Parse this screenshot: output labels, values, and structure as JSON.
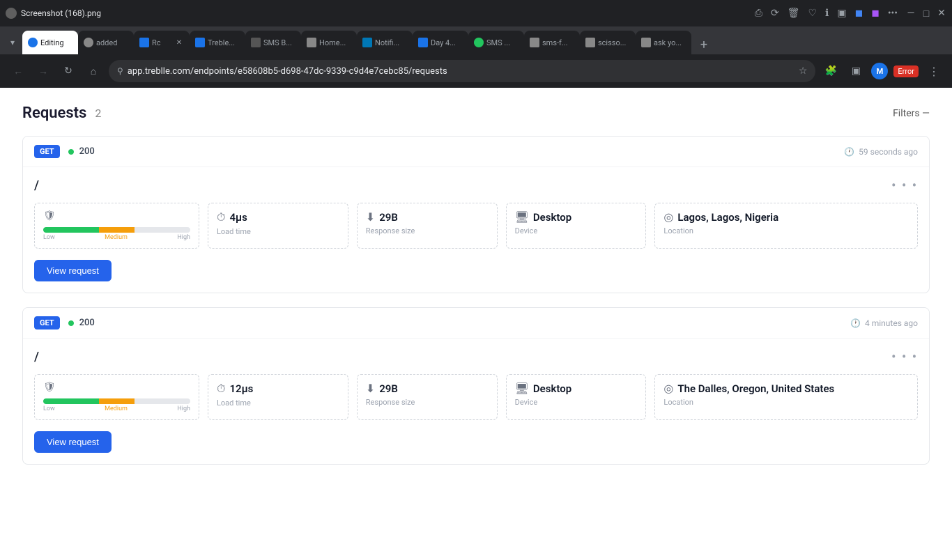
{
  "browser": {
    "title": "Screenshot (168).png",
    "url": "app.treblle.com/endpoints/e58608b5-d698-47dc-9339-c9d4e7cebc85/requests",
    "profile_initial": "M",
    "error_label": "Error"
  },
  "tabs": [
    {
      "id": "t1",
      "label": "Editing",
      "favicon_color": "#1a73e8",
      "active": true,
      "has_close": false
    },
    {
      "id": "t2",
      "label": "added",
      "favicon_color": "#888",
      "active": false,
      "has_close": false
    },
    {
      "id": "t3",
      "label": "Rc",
      "favicon_color": "#1a73e8",
      "active": false,
      "has_close": true
    },
    {
      "id": "t4",
      "label": "Treble...",
      "favicon_color": "#1a73e8",
      "active": false,
      "has_close": false
    },
    {
      "id": "t5",
      "label": "SMS B...",
      "favicon_color": "#555",
      "active": false,
      "has_close": false
    },
    {
      "id": "t6",
      "label": "Home...",
      "favicon_color": "#888",
      "active": false,
      "has_close": false
    },
    {
      "id": "t7",
      "label": "Notifi...",
      "favicon_color": "#0077b5",
      "active": false,
      "has_close": false
    },
    {
      "id": "t8",
      "label": "Day 4...",
      "favicon_color": "#1a73e8",
      "active": false,
      "has_close": false
    },
    {
      "id": "t9",
      "label": "SMS ...",
      "favicon_color": "#22c55e",
      "active": false,
      "has_close": false
    },
    {
      "id": "t10",
      "label": "sms-f...",
      "favicon_color": "#888",
      "active": false,
      "has_close": false
    },
    {
      "id": "t11",
      "label": "scisso...",
      "favicon_color": "#888",
      "active": false,
      "has_close": false
    },
    {
      "id": "t12",
      "label": "ask yo...",
      "favicon_color": "#888",
      "active": false,
      "has_close": false
    }
  ],
  "page": {
    "title": "Requests",
    "count": "2",
    "filters_label": "Filters —"
  },
  "requests": [
    {
      "method": "GET",
      "status_code": "200",
      "timestamp": "59 seconds ago",
      "path": "/",
      "load_time_value": "4μs",
      "load_time_label": "Load time",
      "response_size_value": "29B",
      "response_size_label": "Response size",
      "device_value": "Desktop",
      "device_label": "Device",
      "location_value": "Lagos, Lagos, Nigeria",
      "location_label": "Location",
      "bar_labels": {
        "low": "Low",
        "medium": "Medium",
        "high": "High"
      },
      "view_button": "View request"
    },
    {
      "method": "GET",
      "status_code": "200",
      "timestamp": "4 minutes ago",
      "path": "/",
      "load_time_value": "12μs",
      "load_time_label": "Load time",
      "response_size_value": "29B",
      "response_size_label": "Response size",
      "device_value": "Desktop",
      "device_label": "Device",
      "location_value": "The Dalles, Oregon, United States",
      "location_label": "Location",
      "bar_labels": {
        "low": "Low",
        "medium": "Medium",
        "high": "High"
      },
      "view_button": "View request"
    }
  ],
  "icons": {
    "shield": "🛡",
    "timer": "⏱",
    "download": "⬇",
    "monitor": "🖥",
    "location": "◎",
    "clock": "🕐",
    "more": "•••",
    "back": "←",
    "forward": "→",
    "refresh": "↻",
    "home": "⌂",
    "lock": "🔒",
    "star": "☆",
    "puzzle": "🧩",
    "layout": "▣",
    "minimize": "—",
    "maximize": "□",
    "close": "✕"
  }
}
